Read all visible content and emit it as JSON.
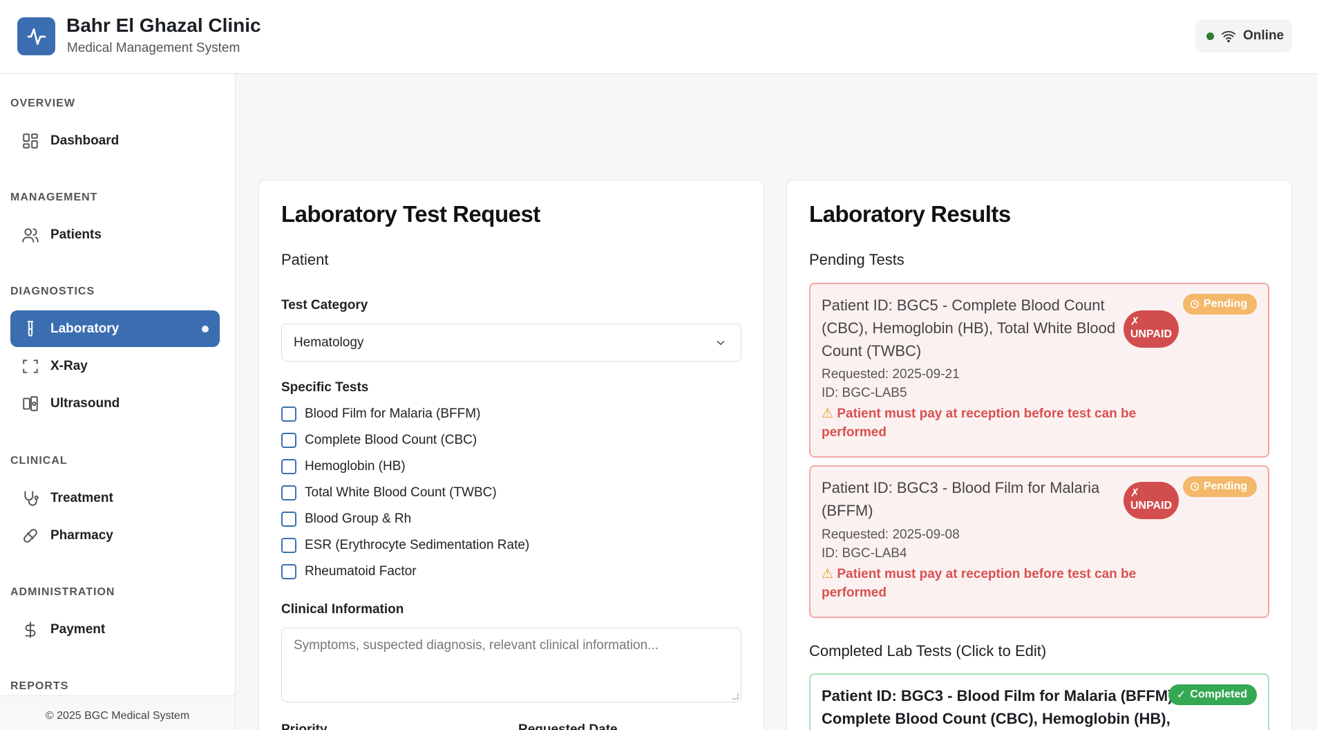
{
  "header": {
    "title": "Bahr El Ghazal Clinic",
    "subtitle": "Medical Management System",
    "status": "Online"
  },
  "sidebar": {
    "sections": [
      {
        "label": "OVERVIEW",
        "items": [
          {
            "label": "Dashboard",
            "icon": "dashboard-icon"
          }
        ]
      },
      {
        "label": "MANAGEMENT",
        "items": [
          {
            "label": "Patients",
            "icon": "users-icon"
          }
        ]
      },
      {
        "label": "DIAGNOSTICS",
        "items": [
          {
            "label": "Laboratory",
            "icon": "test-tube-icon",
            "active": true
          },
          {
            "label": "X-Ray",
            "icon": "scan-icon"
          },
          {
            "label": "Ultrasound",
            "icon": "ultrasound-icon"
          }
        ]
      },
      {
        "label": "CLINICAL",
        "items": [
          {
            "label": "Treatment",
            "icon": "stethoscope-icon"
          },
          {
            "label": "Pharmacy",
            "icon": "pill-icon"
          }
        ]
      },
      {
        "label": "ADMINISTRATION",
        "items": [
          {
            "label": "Payment",
            "icon": "dollar-icon"
          }
        ]
      },
      {
        "label": "REPORTS",
        "items": []
      }
    ],
    "footer": "© 2025 BGC Medical System"
  },
  "request_form": {
    "title": "Laboratory Test Request",
    "patient_label": "Patient",
    "category_label": "Test Category",
    "category_value": "Hematology",
    "specific_tests_label": "Specific Tests",
    "tests": [
      "Blood Film for Malaria (BFFM)",
      "Complete Blood Count (CBC)",
      "Hemoglobin (HB)",
      "Total White Blood Count (TWBC)",
      "Blood Group & Rh",
      "ESR (Erythrocyte Sedimentation Rate)",
      "Rheumatoid Factor"
    ],
    "clinical_label": "Clinical Information",
    "clinical_placeholder": "Symptoms, suspected diagnosis, relevant clinical information...",
    "priority_label": "Priority",
    "requested_date_label": "Requested Date"
  },
  "results": {
    "title": "Laboratory Results",
    "pending_heading": "Pending Tests",
    "pending": [
      {
        "title_lines": [
          "Patient ID: BGC5 - Complete Blood Count",
          "(CBC), Hemoglobin (HB), Total White Blood",
          "Count (TWBC)"
        ],
        "requested": "Requested: 2025-09-21",
        "id": "ID: BGC-LAB5",
        "warning_lines": [
          "Patient must pay at reception before test can be",
          "performed"
        ],
        "status": "Pending",
        "payment_lines": [
          "✗",
          "UNPAID"
        ]
      },
      {
        "title_lines": [
          "Patient ID: BGC3 - Blood Film for Malaria",
          "(BFFM)"
        ],
        "requested": "Requested: 2025-09-08",
        "id": "ID: BGC-LAB4",
        "warning_lines": [
          "Patient must pay at reception before test can be",
          "performed"
        ],
        "status": "Pending",
        "payment_lines": [
          "✗",
          "UNPAID"
        ]
      }
    ],
    "completed_heading": "Completed Lab Tests (Click to Edit)",
    "completed": [
      {
        "title_lines": [
          "Patient ID: BGC3 - Blood Film for Malaria (BFFM),",
          "Complete Blood Count (CBC), Hemoglobin (HB),"
        ],
        "status": "Completed"
      }
    ]
  },
  "colors": {
    "primary": "#3b6eb1",
    "pending": "#f4b86a",
    "unpaid": "#d24d4d",
    "completed": "#34a853",
    "online": "#2e7d32"
  }
}
